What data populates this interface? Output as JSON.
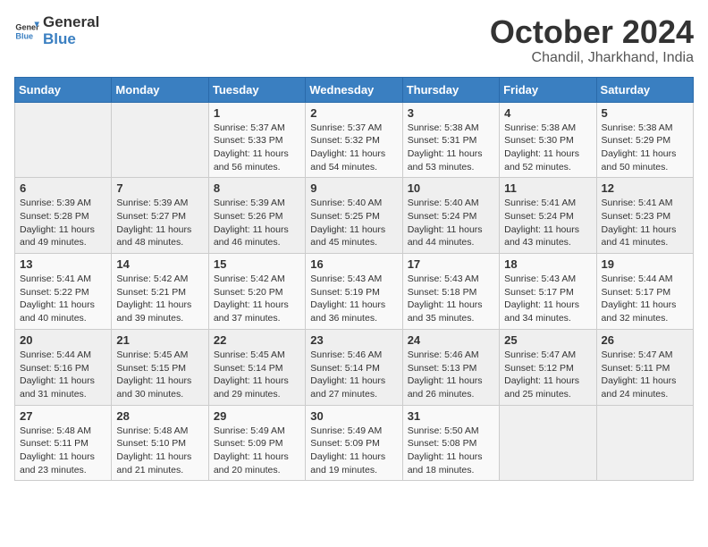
{
  "header": {
    "logo_general": "General",
    "logo_blue": "Blue",
    "month_title": "October 2024",
    "location": "Chandil, Jharkhand, India"
  },
  "calendar": {
    "days_of_week": [
      "Sunday",
      "Monday",
      "Tuesday",
      "Wednesday",
      "Thursday",
      "Friday",
      "Saturday"
    ],
    "weeks": [
      [
        {
          "day": "",
          "info": ""
        },
        {
          "day": "",
          "info": ""
        },
        {
          "day": "1",
          "info": "Sunrise: 5:37 AM\nSunset: 5:33 PM\nDaylight: 11 hours and 56 minutes."
        },
        {
          "day": "2",
          "info": "Sunrise: 5:37 AM\nSunset: 5:32 PM\nDaylight: 11 hours and 54 minutes."
        },
        {
          "day": "3",
          "info": "Sunrise: 5:38 AM\nSunset: 5:31 PM\nDaylight: 11 hours and 53 minutes."
        },
        {
          "day": "4",
          "info": "Sunrise: 5:38 AM\nSunset: 5:30 PM\nDaylight: 11 hours and 52 minutes."
        },
        {
          "day": "5",
          "info": "Sunrise: 5:38 AM\nSunset: 5:29 PM\nDaylight: 11 hours and 50 minutes."
        }
      ],
      [
        {
          "day": "6",
          "info": "Sunrise: 5:39 AM\nSunset: 5:28 PM\nDaylight: 11 hours and 49 minutes."
        },
        {
          "day": "7",
          "info": "Sunrise: 5:39 AM\nSunset: 5:27 PM\nDaylight: 11 hours and 48 minutes."
        },
        {
          "day": "8",
          "info": "Sunrise: 5:39 AM\nSunset: 5:26 PM\nDaylight: 11 hours and 46 minutes."
        },
        {
          "day": "9",
          "info": "Sunrise: 5:40 AM\nSunset: 5:25 PM\nDaylight: 11 hours and 45 minutes."
        },
        {
          "day": "10",
          "info": "Sunrise: 5:40 AM\nSunset: 5:24 PM\nDaylight: 11 hours and 44 minutes."
        },
        {
          "day": "11",
          "info": "Sunrise: 5:41 AM\nSunset: 5:24 PM\nDaylight: 11 hours and 43 minutes."
        },
        {
          "day": "12",
          "info": "Sunrise: 5:41 AM\nSunset: 5:23 PM\nDaylight: 11 hours and 41 minutes."
        }
      ],
      [
        {
          "day": "13",
          "info": "Sunrise: 5:41 AM\nSunset: 5:22 PM\nDaylight: 11 hours and 40 minutes."
        },
        {
          "day": "14",
          "info": "Sunrise: 5:42 AM\nSunset: 5:21 PM\nDaylight: 11 hours and 39 minutes."
        },
        {
          "day": "15",
          "info": "Sunrise: 5:42 AM\nSunset: 5:20 PM\nDaylight: 11 hours and 37 minutes."
        },
        {
          "day": "16",
          "info": "Sunrise: 5:43 AM\nSunset: 5:19 PM\nDaylight: 11 hours and 36 minutes."
        },
        {
          "day": "17",
          "info": "Sunrise: 5:43 AM\nSunset: 5:18 PM\nDaylight: 11 hours and 35 minutes."
        },
        {
          "day": "18",
          "info": "Sunrise: 5:43 AM\nSunset: 5:17 PM\nDaylight: 11 hours and 34 minutes."
        },
        {
          "day": "19",
          "info": "Sunrise: 5:44 AM\nSunset: 5:17 PM\nDaylight: 11 hours and 32 minutes."
        }
      ],
      [
        {
          "day": "20",
          "info": "Sunrise: 5:44 AM\nSunset: 5:16 PM\nDaylight: 11 hours and 31 minutes."
        },
        {
          "day": "21",
          "info": "Sunrise: 5:45 AM\nSunset: 5:15 PM\nDaylight: 11 hours and 30 minutes."
        },
        {
          "day": "22",
          "info": "Sunrise: 5:45 AM\nSunset: 5:14 PM\nDaylight: 11 hours and 29 minutes."
        },
        {
          "day": "23",
          "info": "Sunrise: 5:46 AM\nSunset: 5:14 PM\nDaylight: 11 hours and 27 minutes."
        },
        {
          "day": "24",
          "info": "Sunrise: 5:46 AM\nSunset: 5:13 PM\nDaylight: 11 hours and 26 minutes."
        },
        {
          "day": "25",
          "info": "Sunrise: 5:47 AM\nSunset: 5:12 PM\nDaylight: 11 hours and 25 minutes."
        },
        {
          "day": "26",
          "info": "Sunrise: 5:47 AM\nSunset: 5:11 PM\nDaylight: 11 hours and 24 minutes."
        }
      ],
      [
        {
          "day": "27",
          "info": "Sunrise: 5:48 AM\nSunset: 5:11 PM\nDaylight: 11 hours and 23 minutes."
        },
        {
          "day": "28",
          "info": "Sunrise: 5:48 AM\nSunset: 5:10 PM\nDaylight: 11 hours and 21 minutes."
        },
        {
          "day": "29",
          "info": "Sunrise: 5:49 AM\nSunset: 5:09 PM\nDaylight: 11 hours and 20 minutes."
        },
        {
          "day": "30",
          "info": "Sunrise: 5:49 AM\nSunset: 5:09 PM\nDaylight: 11 hours and 19 minutes."
        },
        {
          "day": "31",
          "info": "Sunrise: 5:50 AM\nSunset: 5:08 PM\nDaylight: 11 hours and 18 minutes."
        },
        {
          "day": "",
          "info": ""
        },
        {
          "day": "",
          "info": ""
        }
      ]
    ]
  }
}
